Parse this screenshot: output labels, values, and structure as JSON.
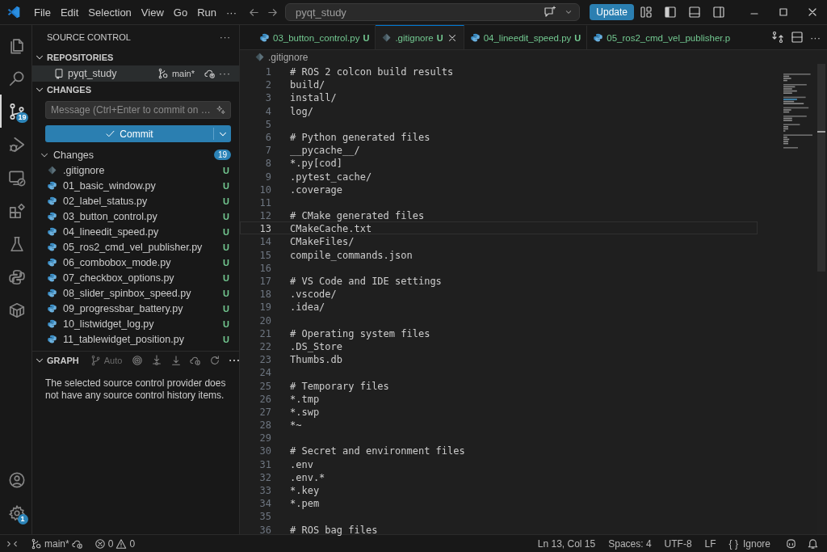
{
  "title_bar": {
    "menu": [
      "File",
      "Edit",
      "Selection",
      "View",
      "Go",
      "Run",
      "···"
    ],
    "search": {
      "value": "pyqt_study"
    },
    "update_button": "Update"
  },
  "activity_bar": {
    "items": [
      {
        "kind": "files",
        "selected": false
      },
      {
        "kind": "search",
        "selected": false
      },
      {
        "kind": "source-control",
        "selected": true,
        "badge": "19"
      },
      {
        "kind": "run",
        "selected": false
      },
      {
        "kind": "remote",
        "selected": false
      },
      {
        "kind": "extensions",
        "selected": false
      },
      {
        "kind": "testing",
        "selected": false
      },
      {
        "kind": "python",
        "selected": false
      },
      {
        "kind": "container",
        "selected": false
      }
    ],
    "bottom": [
      {
        "kind": "account"
      },
      {
        "kind": "settings",
        "badge": "1"
      }
    ]
  },
  "sidebar": {
    "title": "SOURCE CONTROL",
    "more": "···",
    "repositories": {
      "title": "REPOSITORIES",
      "expanded": true,
      "items": [
        {
          "name": "pyqt_study",
          "branch": "main*",
          "more": "···",
          "selected": true
        }
      ]
    },
    "changes_section": {
      "title": "CHANGES",
      "expanded": true
    },
    "message": {
      "placeholder": "Message (Ctrl+Enter to commit on …"
    },
    "commit_button": "Commit",
    "changes": {
      "label": "Changes",
      "count": "19",
      "expanded": true,
      "files": [
        {
          "name": ".gitignore",
          "kind": "gitignore",
          "status": "U"
        },
        {
          "name": "01_basic_window.py",
          "kind": "python",
          "status": "U"
        },
        {
          "name": "02_label_status.py",
          "kind": "python",
          "status": "U"
        },
        {
          "name": "03_button_control.py",
          "kind": "python",
          "status": "U"
        },
        {
          "name": "04_lineedit_speed.py",
          "kind": "python",
          "status": "U"
        },
        {
          "name": "05_ros2_cmd_vel_publisher.py",
          "kind": "python",
          "status": "U"
        },
        {
          "name": "06_combobox_mode.py",
          "kind": "python",
          "status": "U"
        },
        {
          "name": "07_checkbox_options.py",
          "kind": "python",
          "status": "U"
        },
        {
          "name": "08_slider_spinbox_speed.py",
          "kind": "python",
          "status": "U"
        },
        {
          "name": "09_progressbar_battery.py",
          "kind": "python",
          "status": "U"
        },
        {
          "name": "10_listwidget_log.py",
          "kind": "python",
          "status": "U"
        },
        {
          "name": "11_tablewidget_position.py",
          "kind": "python",
          "status": "U"
        }
      ]
    },
    "graph": {
      "title": "GRAPH",
      "auto": "Auto",
      "more": "···",
      "expanded": true,
      "message": "The selected source control provider does not have any source control history items."
    }
  },
  "tabs": [
    {
      "label": "03_button_control.py",
      "status": "U",
      "kind": "python",
      "selected": false
    },
    {
      "label": ".gitignore",
      "status": "U",
      "kind": "gitignore",
      "selected": true
    },
    {
      "label": "04_lineedit_speed.py",
      "status": "U",
      "kind": "python",
      "selected": false
    },
    {
      "label": "05_ros2_cmd_vel_publisher.p",
      "kind": "python",
      "selected": false
    }
  ],
  "tab_actions": {
    "more": "···"
  },
  "breadcrumb": ".gitignore",
  "editor": {
    "lines": [
      {
        "n": "1",
        "text": "# ROS 2 colcon build results",
        "selected": false
      },
      {
        "n": "2",
        "text": "build/",
        "selected": false
      },
      {
        "n": "3",
        "text": "install/",
        "selected": false
      },
      {
        "n": "4",
        "text": "log/",
        "selected": false
      },
      {
        "n": "5",
        "selected": false
      },
      {
        "n": "6",
        "text": "# Python generated files",
        "selected": false
      },
      {
        "n": "7",
        "text": "__pycache__/",
        "selected": false
      },
      {
        "n": "8",
        "text": "*.py[cod]",
        "selected": false
      },
      {
        "n": "9",
        "text": ".pytest_cache/",
        "selected": false
      },
      {
        "n": "10",
        "text": ".coverage",
        "selected": false
      },
      {
        "n": "11",
        "selected": false
      },
      {
        "n": "12",
        "text": "# CMake generated files",
        "selected": false
      },
      {
        "n": "13",
        "text": "CMakeCache.txt",
        "selected": true
      },
      {
        "n": "14",
        "text": "CMakeFiles/",
        "selected": false
      },
      {
        "n": "15",
        "text": "compile_commands.json",
        "selected": false
      },
      {
        "n": "16",
        "selected": false
      },
      {
        "n": "17",
        "text": "# VS Code and IDE settings",
        "selected": false
      },
      {
        "n": "18",
        "text": ".vscode/",
        "selected": false
      },
      {
        "n": "19",
        "text": ".idea/",
        "selected": false
      },
      {
        "n": "20",
        "selected": false
      },
      {
        "n": "21",
        "text": "# Operating system files",
        "selected": false
      },
      {
        "n": "22",
        "text": ".DS_Store",
        "selected": false
      },
      {
        "n": "23",
        "text": "Thumbs.db",
        "selected": false
      },
      {
        "n": "24",
        "selected": false
      },
      {
        "n": "25",
        "text": "# Temporary files",
        "selected": false
      },
      {
        "n": "26",
        "text": "*.tmp",
        "selected": false
      },
      {
        "n": "27",
        "text": "*.swp",
        "selected": false
      },
      {
        "n": "28",
        "text": "*~",
        "selected": false
      },
      {
        "n": "29",
        "selected": false
      },
      {
        "n": "30",
        "text": "# Secret and environment files",
        "selected": false
      },
      {
        "n": "31",
        "text": ".env",
        "selected": false
      },
      {
        "n": "32",
        "text": ".env.*",
        "selected": false
      },
      {
        "n": "33",
        "text": "*.key",
        "selected": false
      },
      {
        "n": "34",
        "text": "*.pem",
        "selected": false
      },
      {
        "n": "35",
        "selected": false
      },
      {
        "n": "36",
        "text": "# ROS bag files",
        "selected": false
      }
    ]
  },
  "status_bar": {
    "branch": "main*",
    "errors": "0",
    "warnings": "0",
    "items": [
      "Ln 13, Col 15",
      "Spaces: 4",
      "UTF-8",
      "LF"
    ],
    "language": {
      "icon": "{ }",
      "label": "Ignore"
    }
  }
}
